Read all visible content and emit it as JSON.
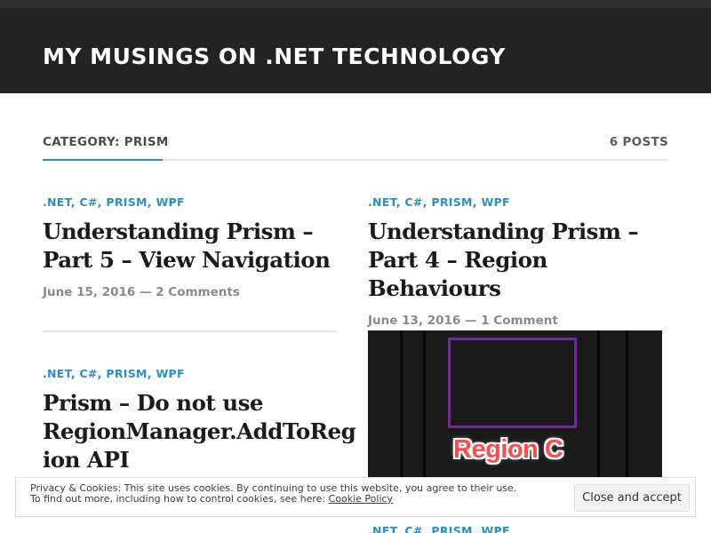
{
  "site": {
    "title": "MY MUSINGS ON .NET TECHNOLOGY"
  },
  "archive": {
    "title": "CATEGORY: PRISM",
    "count": "6 POSTS"
  },
  "posts": [
    {
      "categories": [
        ".NET",
        "C#",
        "PRISM",
        "WPF"
      ],
      "title_line1": "Understanding Prism –",
      "title_line2": "Part 5 – View Navigation",
      "date": "June 15, 2016",
      "separator": "—",
      "comments": "2 Comments"
    },
    {
      "categories": [
        ".NET",
        "C#",
        "PRISM",
        "WPF"
      ],
      "title_line1": "Understanding Prism –",
      "title_line2": "Part 4 – Region Behaviours",
      "date": "June 13, 2016",
      "separator": "—",
      "comments": "1 Comment"
    },
    {
      "categories": [
        ".NET",
        "C#",
        "PRISM",
        "WPF"
      ],
      "title_line1": "Prism – Do not use",
      "title_line2": "RegionManager.AddToReg",
      "title_line3": "ion API"
    },
    {
      "categories": [
        ".NET",
        "C#",
        "PRISM",
        "WPF"
      ]
    }
  ],
  "featured_image": {
    "label": "Region C",
    "box_color": "#6d2f93",
    "label_color": "#ff4d4d"
  },
  "cookie_notice": {
    "line1": "Privacy & Cookies: This site uses cookies. By continuing to use this website, you agree to their use.",
    "line2_prefix": "To find out more, including how to control cookies, see here: ",
    "link": "Cookie Policy",
    "button": "Close and accept"
  },
  "colors": {
    "header_bg": "#242323",
    "accent": "#2b8fc2",
    "title_text": "#1b1b1b",
    "meta_text": "#8a8a8a"
  }
}
